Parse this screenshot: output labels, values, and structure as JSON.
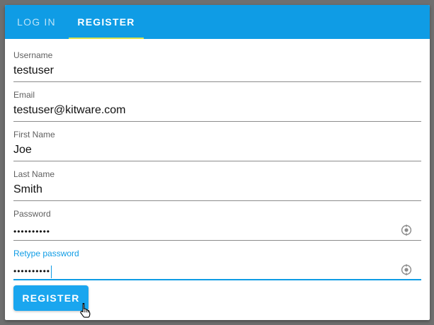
{
  "tabs": [
    {
      "label": "LOG IN"
    },
    {
      "label": "REGISTER"
    }
  ],
  "form": {
    "fields": [
      {
        "label": "Username",
        "value": "testuser"
      },
      {
        "label": "Email",
        "value": "testuser@kitware.com"
      },
      {
        "label": "First Name",
        "value": "Joe"
      },
      {
        "label": "Last Name",
        "value": "Smith"
      },
      {
        "label": "Password",
        "value": "••••••••••"
      },
      {
        "label": "Retype password",
        "value": "••••••••••"
      }
    ],
    "register_button": "REGISTER"
  },
  "icons": {
    "password_toggle": "eye-icon",
    "cursor": "hand-pointer-icon"
  },
  "colors": {
    "primary": "#0f9ce5",
    "tab_indicator": "#d8e24c",
    "backdrop": "#6f6f6f"
  }
}
